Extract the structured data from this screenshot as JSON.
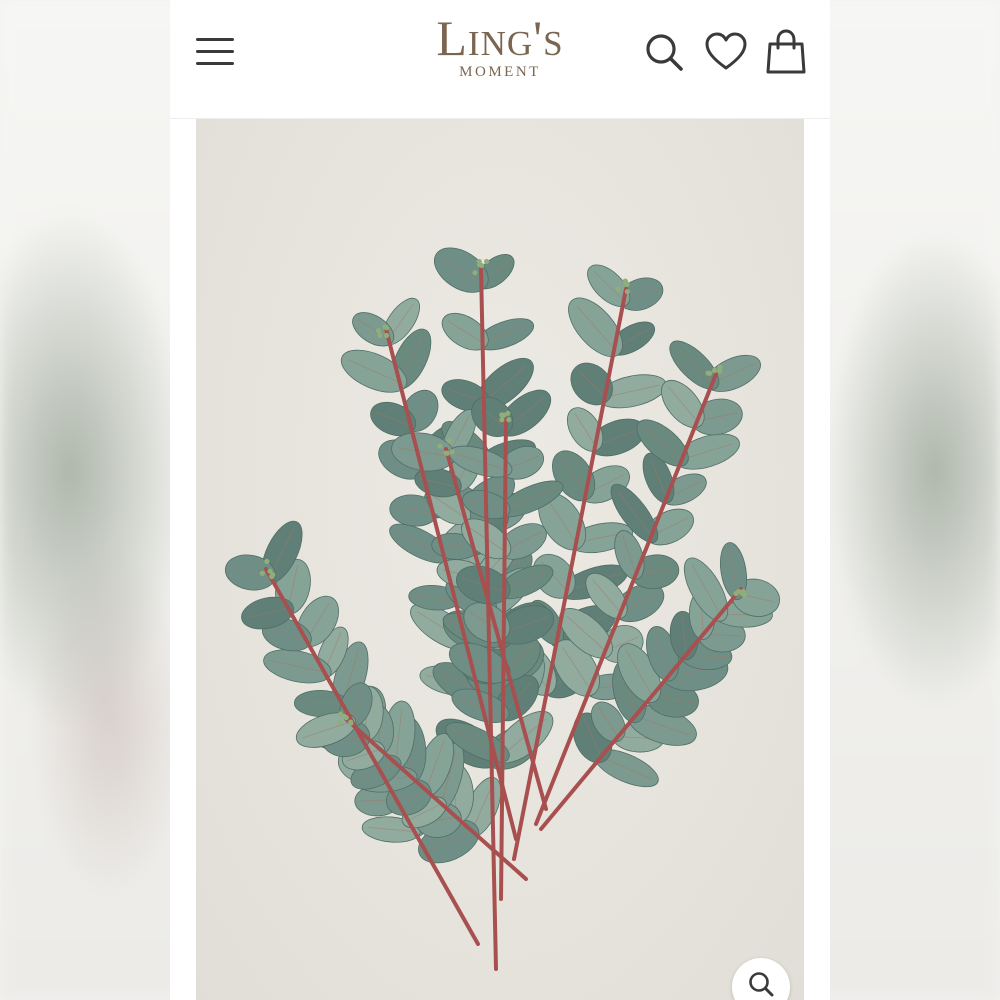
{
  "header": {
    "logo_main": "Ling's",
    "logo_sub": "MOMENT",
    "menu_icon": "hamburger-menu-icon",
    "search_icon": "search-icon",
    "wishlist_icon": "heart-icon",
    "cart_icon": "shopping-bag-icon"
  },
  "product": {
    "image_subject": "eucalyptus-stems",
    "zoom_icon": "zoom-icon"
  },
  "colors": {
    "brand": "#7a6650",
    "icon": "#3a3a3a",
    "leaf": "#6f8f86",
    "stem": "#a8504f",
    "background": "#e6e3dc"
  }
}
